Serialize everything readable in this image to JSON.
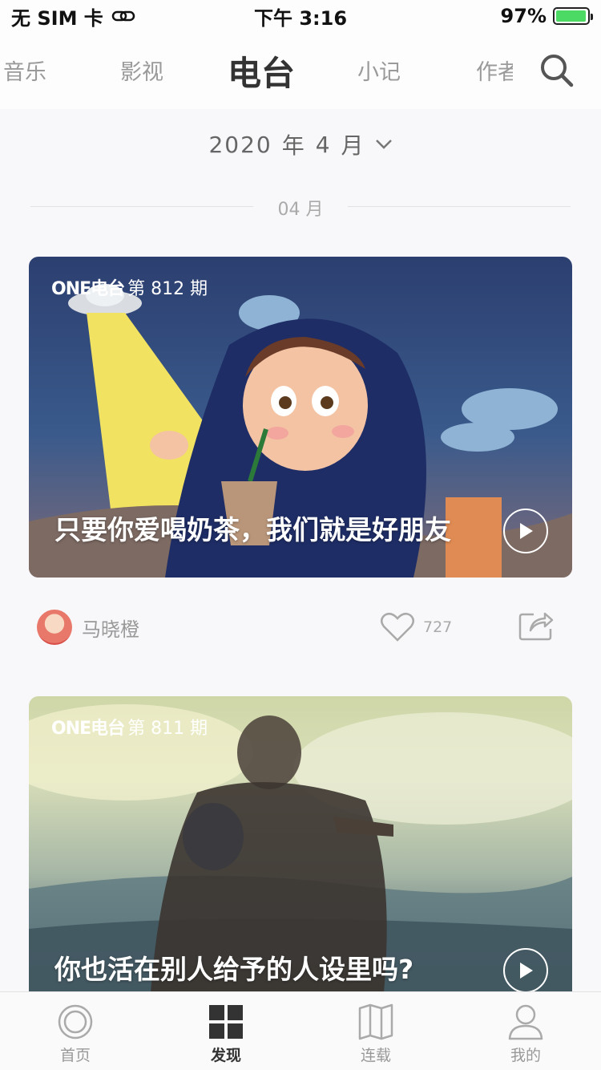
{
  "status_bar": {
    "carrier": "无 SIM 卡",
    "time": "下午 3:16",
    "battery_percent": "97%",
    "battery_level": 0.97
  },
  "top_nav": {
    "tabs": [
      {
        "label": "音乐",
        "active": false
      },
      {
        "label": "影视",
        "active": false
      },
      {
        "label": "电台",
        "active": true
      },
      {
        "label": "小记",
        "active": false
      },
      {
        "label": "作者",
        "active": false
      }
    ],
    "search_icon": "search-icon"
  },
  "month_selector": {
    "year": "2020",
    "year_unit": "年",
    "month": "4",
    "month_unit": "月",
    "chevron_icon": "chevron-down-icon"
  },
  "month_divider": {
    "label": "04 月"
  },
  "cards": [
    {
      "brand": "ONE电台",
      "issue": "第 812 期",
      "title": "只要你爱喝奶茶，我们就是好朋友",
      "author": "马晓橙",
      "likes": "727"
    },
    {
      "brand": "ONE电台",
      "issue": "第 811 期",
      "title": "你也活在别人给予的人设里吗?"
    }
  ],
  "tab_bar": {
    "items": [
      {
        "label": "首页",
        "icon": "home-icon",
        "active": false
      },
      {
        "label": "发现",
        "icon": "discover-icon",
        "active": true
      },
      {
        "label": "连载",
        "icon": "book-icon",
        "active": false
      },
      {
        "label": "我的",
        "icon": "profile-icon",
        "active": false
      }
    ]
  },
  "colors": {
    "accent_text": "#333333",
    "muted_text": "#999999",
    "battery_green": "#4cd964"
  }
}
